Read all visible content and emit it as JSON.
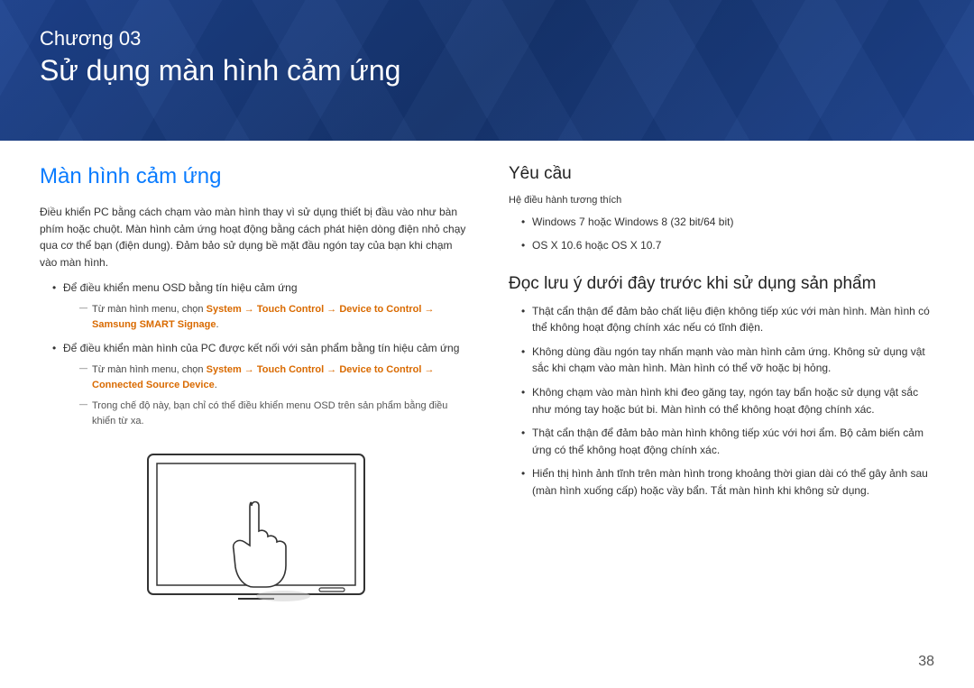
{
  "header": {
    "chapter_label": "Chương 03",
    "chapter_title": "Sử dụng màn hình cảm ứng"
  },
  "left": {
    "heading": "Màn hình cảm ứng",
    "intro": "Điều khiển PC bằng cách chạm vào màn hình thay vì sử dụng thiết bị đầu vào như bàn phím hoặc chuột. Màn hình cảm ứng hoạt động bằng cách phát hiện dòng điện nhỏ chạy qua cơ thể bạn (điện dung). Đảm bảo sử dụng bề mặt đầu ngón tay của bạn khi chạm vào màn hình.",
    "b1": "Để điều khiển menu OSD bằng tín hiệu cảm ứng",
    "b1_sub_pre": "Từ màn hình menu, chọn ",
    "b1_sys": "System",
    "b1_touch": "Touch Control",
    "b1_device": "Device to Control",
    "b1_signage": "Samsung SMART Signage",
    "arrow": " → ",
    "period": ".",
    "b2": "Để điều khiển màn hình của PC được kết nối với sản phẩm bằng tín hiệu cảm ứng",
    "b2_connected": "Connected Source Device",
    "b2_note": "Trong chế độ này, bạn chỉ có thể điều khiển menu OSD trên sản phẩm bằng điều khiển từ xa."
  },
  "right": {
    "req_heading": "Yêu cầu",
    "os_compat": "Hệ điều hành tương thích",
    "os1": "Windows 7 hoặc Windows 8 (32 bit/64 bit)",
    "os2": "OS X 10.6 hoặc OS X 10.7",
    "read_heading": "Đọc lưu ý dưới đây trước khi sử dụng sản phẩm",
    "n1": "Thật cẩn thận để đảm bảo chất liệu điện không tiếp xúc với màn hình. Màn hình có thể không hoạt động chính xác nếu có tĩnh điện.",
    "n2": "Không dùng đầu ngón tay nhấn mạnh vào màn hình cảm ứng. Không sử dụng vật sắc khi chạm vào màn hình. Màn hình có thể vỡ hoặc bị hỏng.",
    "n3": "Không chạm vào màn hình khi đeo găng tay, ngón tay bẩn hoặc sử dụng vật sắc như móng tay hoặc bút bi. Màn hình có thể không hoạt động chính xác.",
    "n4": "Thật cẩn thận để đảm bảo màn hình không tiếp xúc với hơi ẩm. Bộ cảm biến cảm ứng có thể không hoạt động chính xác.",
    "n5": "Hiển thị hình ảnh tĩnh trên màn hình trong khoảng thời gian dài có thể gây ảnh sau (màn hình xuống cấp) hoặc vầy bẩn. Tắt màn hình khi không sử dụng."
  },
  "page_number": "38"
}
